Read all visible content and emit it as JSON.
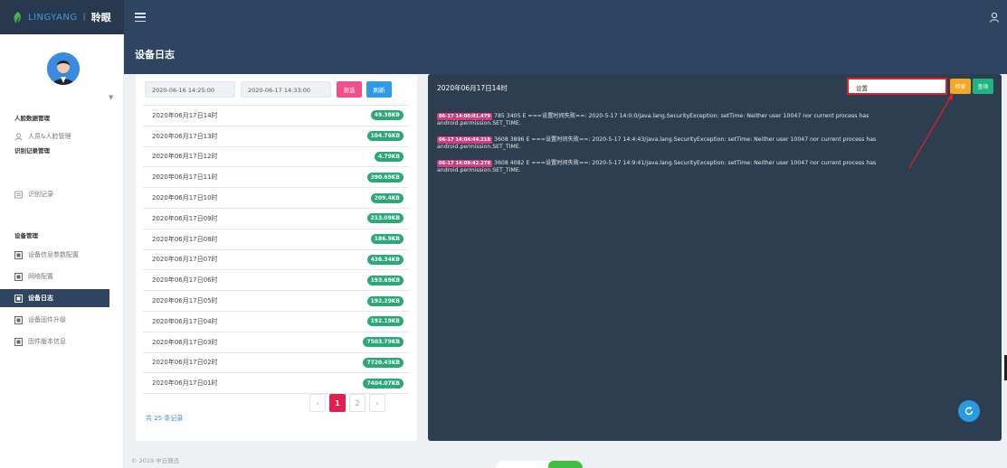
{
  "brand": {
    "en": "LINGYANG",
    "separator": "|",
    "cn": "聆眼"
  },
  "header": {
    "page_title": "设备日志"
  },
  "sidebar": {
    "sections": [
      {
        "title": "人脸数据管理",
        "items": [
          {
            "label": "人员&人脸管理",
            "icon": "person-icon"
          }
        ]
      },
      {
        "title": "识别记录管理",
        "items": [
          {
            "label": "识别记录",
            "icon": "record-icon"
          }
        ]
      },
      {
        "title": "设备管理",
        "items": [
          {
            "label": "设备信息参数配置",
            "icon": "device-icon"
          },
          {
            "label": "网络配置",
            "icon": "device-icon"
          },
          {
            "label": "设备日志",
            "icon": "device-icon",
            "active": true
          },
          {
            "label": "设备固件升级",
            "icon": "device-icon"
          },
          {
            "label": "固件版本信息",
            "icon": "device-icon"
          }
        ]
      }
    ]
  },
  "filters": {
    "start_time": "2020-06-16 14:25:00",
    "end_time": "2020-06-17 14:33:00",
    "filter_label": "筛选",
    "refresh_label": "刷新"
  },
  "files": [
    {
      "name": "2020年06月17日14时",
      "size": "49.38KB"
    },
    {
      "name": "2020年06月17日13时",
      "size": "104.76KB"
    },
    {
      "name": "2020年06月17日12时",
      "size": "4.79KB"
    },
    {
      "name": "2020年06月17日11时",
      "size": "390.69KB"
    },
    {
      "name": "2020年06月17日10时",
      "size": "209.4KB"
    },
    {
      "name": "2020年06月17日09时",
      "size": "213.09KB"
    },
    {
      "name": "2020年06月17日08时",
      "size": "186.9KB"
    },
    {
      "name": "2020年06月17日07时",
      "size": "436.34KB"
    },
    {
      "name": "2020年06月17日06时",
      "size": "193.69KB"
    },
    {
      "name": "2020年06月17日05时",
      "size": "192.29KB"
    },
    {
      "name": "2020年06月17日04时",
      "size": "192.19KB"
    },
    {
      "name": "2020年06月17日03时",
      "size": "7503.79KB"
    },
    {
      "name": "2020年06月17日02时",
      "size": "7720.43KB"
    },
    {
      "name": "2020年06月17日01时",
      "size": "7404.07KB"
    }
  ],
  "pagination": {
    "total_label": "共 25 条记录",
    "prev": "‹",
    "pages": [
      "1",
      "2"
    ],
    "current": "1",
    "next": "›"
  },
  "log": {
    "title": "2020年06月17日14时",
    "search_value": "设置",
    "search_label": "检索",
    "query_label": "查询",
    "lines": [
      {
        "timestamp": "06-17 14:00:01.479",
        "text": "785 3405 E ===设置时间失败==: 2020-5-17 14:0:0/java.lang.SecurityException: setTime: Neither user 10047 nor current process has android.permission.SET_TIME."
      },
      {
        "timestamp": "06-17 14:04:44.218",
        "text": "3608 3896 E ===设置时间失败==: 2020-5-17 14:4:43/java.lang.SecurityException: setTime: Neither user 10047 nor current process has android.permission.SET_TIME."
      },
      {
        "timestamp": "06-17 14:09:42.278",
        "text": "3608 4082 E ===设置时间失败==: 2020-5-17 14:9:41/java.lang.SecurityException: setTime: Neither user 10047 nor current process has android.permission.SET_TIME."
      }
    ]
  },
  "footer": {
    "copyright": "© 2019 中云微迅"
  },
  "colors": {
    "topbar": "#2e4461",
    "accent_pink": "#e0204f",
    "badge_green": "#2aa876",
    "log_bg": "#2d3e50",
    "highlight_red": "#e02020"
  }
}
